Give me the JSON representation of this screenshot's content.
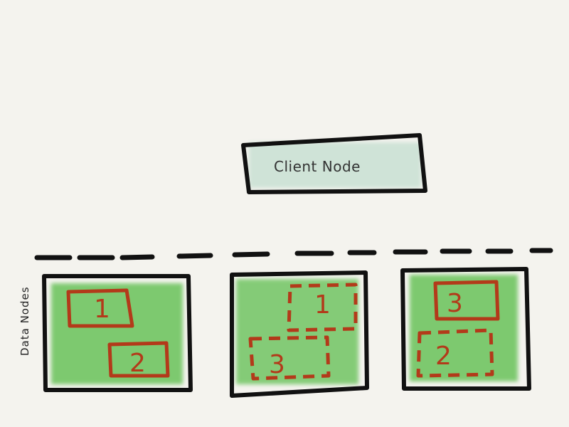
{
  "client": {
    "label": "Client Node"
  },
  "data_nodes_label": "Data Nodes",
  "data_nodes": [
    {
      "shards": [
        {
          "label": "1",
          "type": "primary"
        },
        {
          "label": "2",
          "type": "primary"
        }
      ]
    },
    {
      "shards": [
        {
          "label": "1",
          "type": "replica"
        },
        {
          "label": "3",
          "type": "replica"
        }
      ]
    },
    {
      "shards": [
        {
          "label": "3",
          "type": "primary"
        },
        {
          "label": "2",
          "type": "replica"
        }
      ]
    }
  ],
  "colors": {
    "background": "#f4f3ee",
    "outline": "#111111",
    "client_fill": "#cfe3d7",
    "node_fill": "#69c25a",
    "shard_stroke": "#b33a1a",
    "shard_text": "#b33a1a"
  }
}
